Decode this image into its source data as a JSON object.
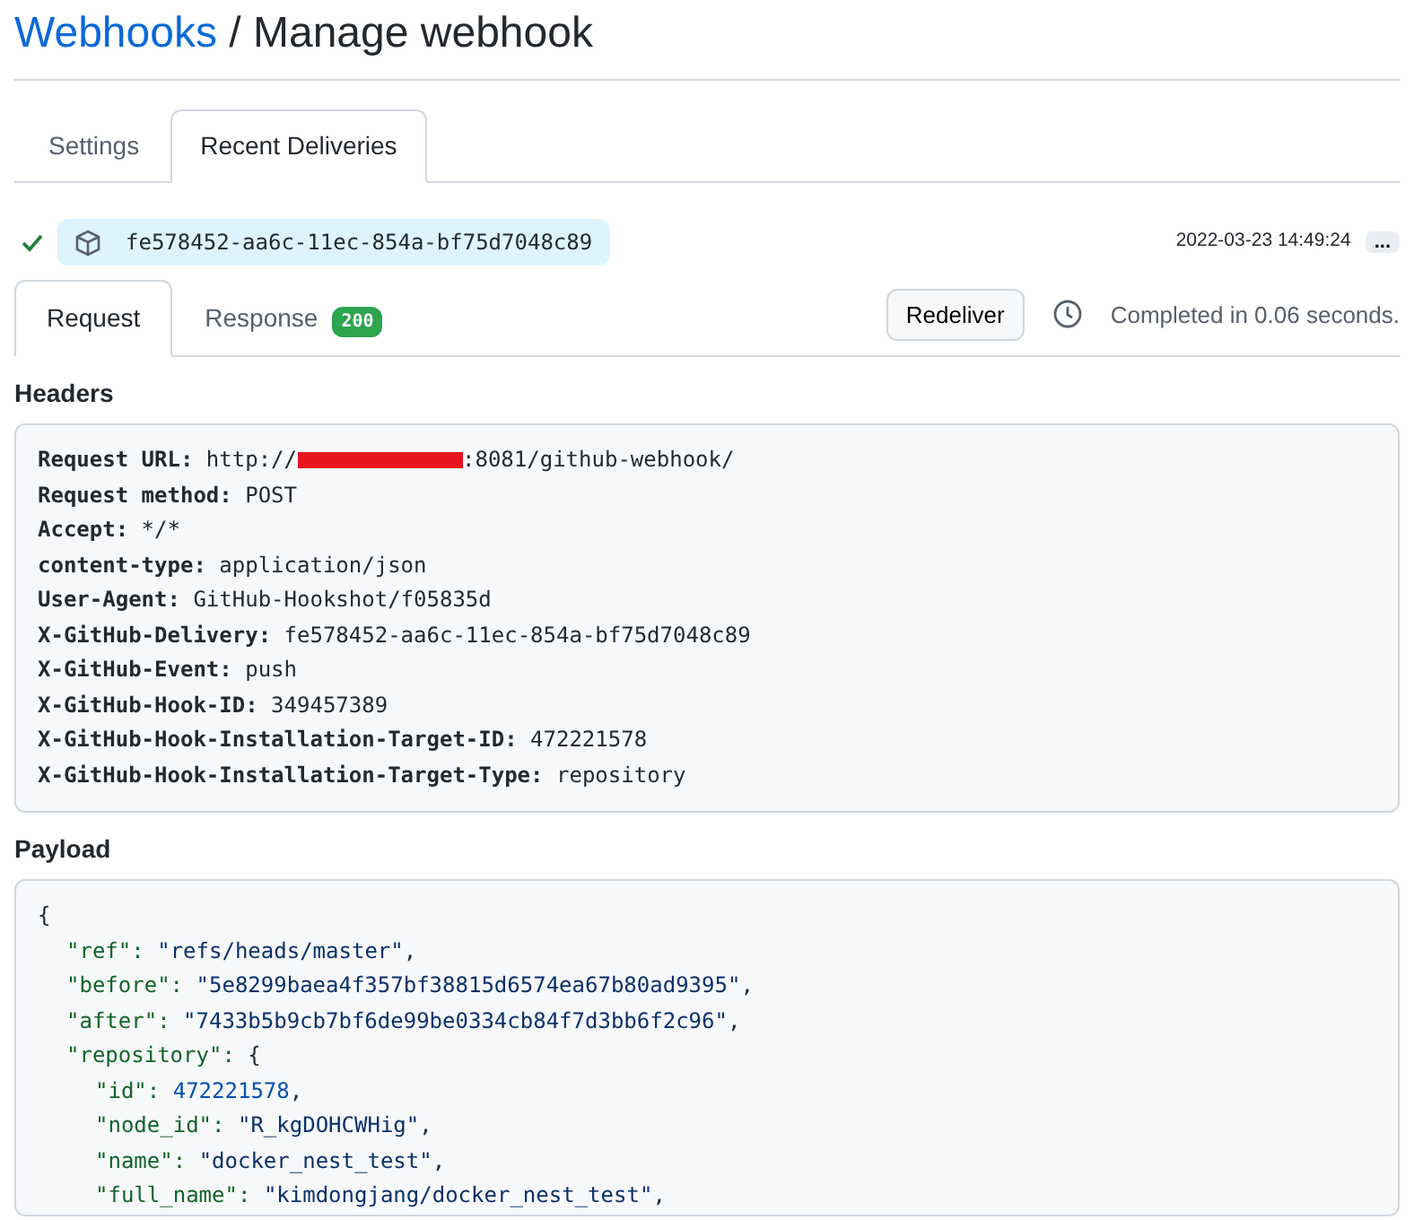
{
  "breadcrumb": {
    "parent": "Webhooks",
    "separator": "/",
    "current": "Manage webhook"
  },
  "tabs": [
    {
      "label": "Settings",
      "selected": false
    },
    {
      "label": "Recent Deliveries",
      "selected": true
    }
  ],
  "delivery": {
    "success": true,
    "guid": "fe578452-aa6c-11ec-854a-bf75d7048c89",
    "timestamp": "2022-03-23 14:49:24",
    "more": "..."
  },
  "detail_tabs": [
    {
      "label": "Request",
      "selected": true
    },
    {
      "label": "Response",
      "selected": false,
      "badge": "200"
    }
  ],
  "redeliver": "Redeliver",
  "completed": "Completed in 0.06 seconds.",
  "headers_title": "Headers",
  "headers": [
    {
      "key": "Request URL:",
      "value": "http://",
      "redacted": true,
      "value_after": ":8081/github-webhook/"
    },
    {
      "key": "Request method:",
      "value": "POST"
    },
    {
      "key": "Accept:",
      "value": "*/*"
    },
    {
      "key": "content-type:",
      "value": "application/json"
    },
    {
      "key": "User-Agent:",
      "value": "GitHub-Hookshot/f05835d"
    },
    {
      "key": "X-GitHub-Delivery:",
      "value": "fe578452-aa6c-11ec-854a-bf75d7048c89"
    },
    {
      "key": "X-GitHub-Event:",
      "value": "push"
    },
    {
      "key": "X-GitHub-Hook-ID:",
      "value": "349457389"
    },
    {
      "key": "X-GitHub-Hook-Installation-Target-ID:",
      "value": "472221578"
    },
    {
      "key": "X-GitHub-Hook-Installation-Target-Type:",
      "value": "repository"
    }
  ],
  "payload_title": "Payload",
  "payload": [
    {
      "open": "{",
      "children": [
        {
          "key": "\"ref\":",
          "value": "\"refs/heads/master\"",
          "kind": "string",
          "tail": ","
        },
        {
          "key": "\"before\":",
          "value": "\"5e8299baea4f357bf38815d6574ea67b80ad9395\"",
          "kind": "string",
          "tail": ","
        },
        {
          "key": "\"after\":",
          "value": "\"7433b5b9cb7bf6de99be0334cb84f7d3bb6f2c96\"",
          "kind": "string",
          "tail": ","
        },
        {
          "key": "\"repository\":",
          "open": "{",
          "children": [
            {
              "key": "\"id\":",
              "value": "472221578",
              "kind": "number",
              "tail": ","
            },
            {
              "key": "\"node_id\":",
              "value": "\"R_kgDOHCWHig\"",
              "kind": "string",
              "tail": ","
            },
            {
              "key": "\"name\":",
              "value": "\"docker_nest_test\"",
              "kind": "string",
              "tail": ","
            },
            {
              "key": "\"full_name\":",
              "value": "\"kimdongjang/docker_nest_test\"",
              "kind": "string",
              "tail": ","
            }
          ]
        }
      ]
    }
  ]
}
